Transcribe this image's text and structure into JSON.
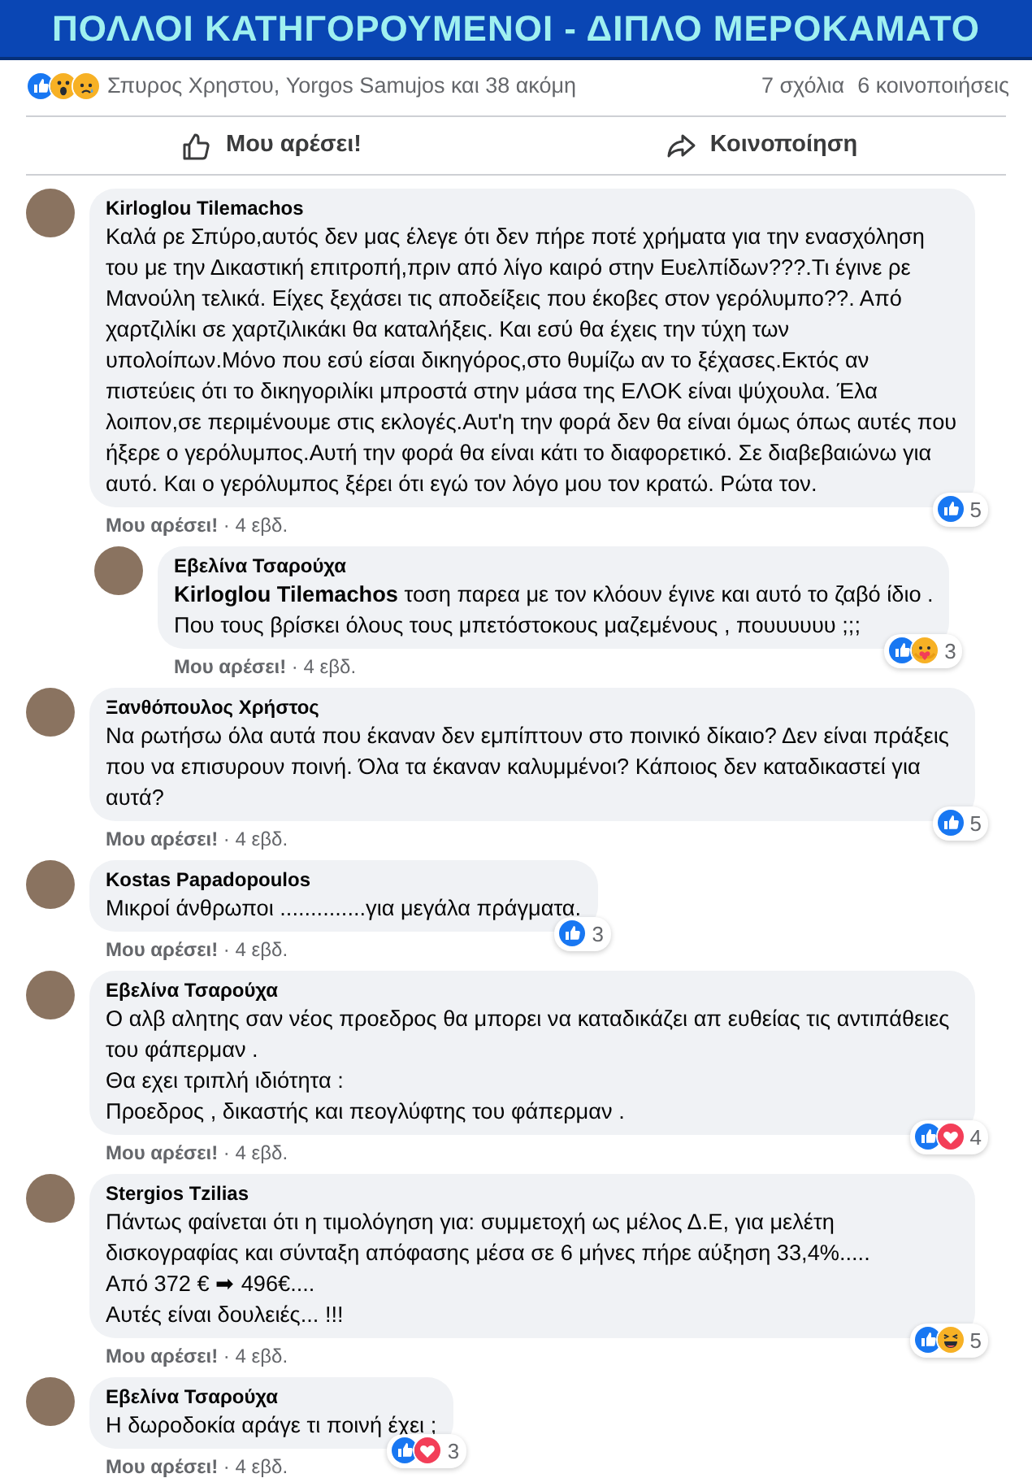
{
  "banner": {
    "title": "ΠΟΛΛΟΙ ΚΑΤΗΓΟΡΟΥΜΕΝΟΙ - ΔΙΠΛΟ ΜΕΡΟΚΑΜΑΤΟ"
  },
  "stats": {
    "reactions": [
      {
        "kind": "like"
      },
      {
        "kind": "wow"
      },
      {
        "kind": "sad"
      }
    ],
    "names": "Σπυρος Χρηστου, Yorgos Samujos και 38 ακόμη",
    "comments": "7 σχόλια",
    "shares": "6 κοινοποιήσεις"
  },
  "actions": [
    {
      "kind": "like",
      "label": "Μου αρέσει!"
    },
    {
      "kind": "share",
      "label": "Κοινοποίηση"
    }
  ],
  "comments": [
    {
      "author": "Kirloglou Tilemachos",
      "text": "Καλά ρε Σπύρο,αυτός δεν μας έλεγε ότι δεν πήρε ποτέ χρήματα για την ενασχόληση του με την Δικαστική επιτροπή,πριν από λίγο καιρό στην Ευελπίδων???.Τι έγινε ρε Μανούλη τελικά. Είχες ξεχάσει τις αποδείξεις που έκοβες στον γερόλυμπο??. Από χαρτζιλίκι σε χαρτζιλικάκι θα καταλήξεις. Και εσύ θα έχεις την τύχη των υπολοίπων.Μόνο που εσύ είσαι δικηγόρος,στο θυμίζω αν το ξέχασες.Εκτός αν πιστεύεις ότι το δικηγοριλίκι μπροστά στην μάσα της ΕΛΟΚ είναι ψύχουλα. Έλα λοιπον,σε περιμένουμε στις εκλογές.Αυτ'η την φορά δεν θα είναι όμως όπως αυτές που ήξερε ο γερόλυμπος.Αυτή την φορά θα είναι κάτι το διαφορετικό. Σε διαβεβαιώνω για αυτό. Και ο γερόλυμπος ξέρει ότι εγώ τον λόγο μου τον κρατώ. Ρώτα τον.",
      "like": "Μου αρέσει!",
      "sep": "·",
      "time": "4 εβδ.",
      "reactions": [
        {
          "kind": "like"
        }
      ],
      "count": "5",
      "replies": [
        {
          "author": "Εβελίνα Τσαρούχα",
          "text": "**Kirloglou Tilemachos** τοση παρεα με τον κλόουν έγινε και αυτό το ζαβό ίδιο .\nΠου τους βρίσκει όλους τους μπετόστοκους μαζεμένους , πουυυυυυ ;;;",
          "like": "Μου αρέσει!",
          "sep": "·",
          "time": "4 εβδ.",
          "reactions": [
            {
              "kind": "like"
            },
            {
              "kind": "care"
            }
          ],
          "count": "3"
        }
      ]
    },
    {
      "author": "Ξανθόπουλος Χρήστος",
      "text": "Να ρωτήσω όλα αυτά που έκαναν δεν εμπίπτουν στο ποινικό δίκαιο? Δεν είναι πράξεις που να επισυρουν ποινή. Όλα τα έκαναν καλυμμένοι? Κάποιος δεν καταδικαστεί για αυτά?",
      "like": "Μου αρέσει!",
      "sep": "·",
      "time": "4 εβδ.",
      "reactions": [
        {
          "kind": "like"
        }
      ],
      "count": "5"
    },
    {
      "author": "Kostas Papadopoulos",
      "text": "Μικροί άνθρωποι ..............για μεγάλα πράγματα.",
      "like": "Μου αρέσει!",
      "sep": "·",
      "time": "4 εβδ.",
      "reactions": [
        {
          "kind": "like"
        }
      ],
      "count": "3"
    },
    {
      "author": "Εβελίνα Τσαρούχα",
      "text": "Ο αλβ αλητης σαν νέος προεδρος θα μπορει να καταδικάζει απ ευθείας τις αντιπάθειες του φάπερμαν .\nΘα εχει τριπλή ιδιότητα :\nΠροεδρος , δικαστής και πεογλύφτης του φάπερμαν .",
      "like": "Μου αρέσει!",
      "sep": "·",
      "time": "4 εβδ.",
      "reactions": [
        {
          "kind": "like"
        },
        {
          "kind": "love"
        }
      ],
      "count": "4"
    },
    {
      "author": "Stergios Tzilias",
      "text": "Πάντως φαίνεται ότι η τιμολόγηση για: συμμετοχή ως μέλος Δ.Ε, για μελέτη δισκογραφίας και σύνταξη απόφασης μέσα σε 6 μήνες πήρε αύξηση 33,4%.....\nΑπό 372 € ➡ 496€....\nΑυτές είναι δουλειές... !!!",
      "like": "Μου αρέσει!",
      "sep": "·",
      "time": "4 εβδ.",
      "reactions": [
        {
          "kind": "like"
        },
        {
          "kind": "haha"
        }
      ],
      "count": "5"
    },
    {
      "author": "Εβελίνα Τσαρούχα",
      "text": "Η δωροδοκία αράγε τι ποινή έχει ;",
      "like": "Μου αρέσει!",
      "sep": "·",
      "time": "4 εβδ.",
      "reactions": [
        {
          "kind": "like"
        },
        {
          "kind": "love"
        }
      ],
      "count": "3"
    }
  ]
}
